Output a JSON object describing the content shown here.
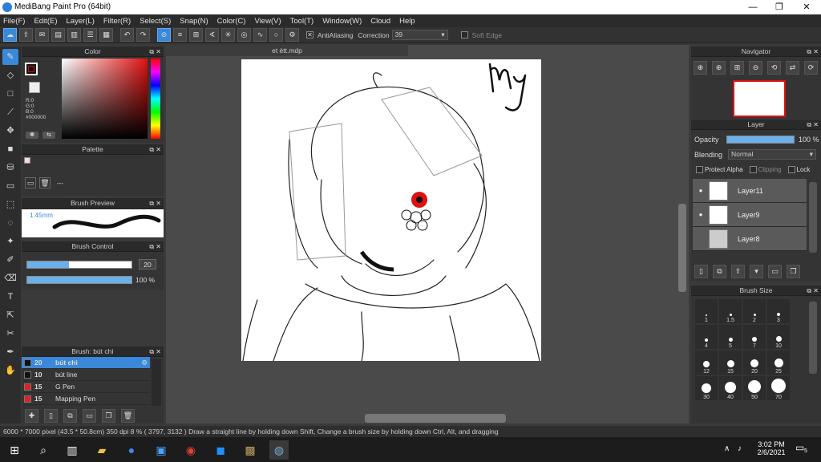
{
  "window": {
    "title": "MediBang Paint Pro (64bit)",
    "min": "—",
    "max": "❐",
    "close": "✕"
  },
  "menu": [
    "File(F)",
    "Edit(E)",
    "Layer(L)",
    "Filter(R)",
    "Select(S)",
    "Snap(N)",
    "Color(C)",
    "View(V)",
    "Tool(T)",
    "Window(W)",
    "Cloud",
    "Help"
  ],
  "toolbar": {
    "antialiasing_label": "AntiAliasing",
    "correction_label": "Correction",
    "correction_value": "39",
    "soft_edge_label": "Soft Edge"
  },
  "color_panel": {
    "title": "Color",
    "r": "R:0",
    "g": "G:0",
    "b": "B:0",
    "hex": "#000000",
    "fg_color": "#cc1111"
  },
  "palette_panel": {
    "title": "Palette",
    "item": "---"
  },
  "brush_preview": {
    "title": "Brush Preview",
    "size": "1.45mm"
  },
  "brush_control": {
    "title": "Brush Control",
    "size_value": "20",
    "opacity_value": "100 %",
    "size_fill": 0.4,
    "opacity_fill": 1.0
  },
  "brush_list": {
    "title": "Brush: bút chì",
    "items": [
      {
        "num": "20",
        "name": "bút chì",
        "color": "#111111",
        "selected": true
      },
      {
        "num": "10",
        "name": "bút line",
        "color": "#111111",
        "selected": false
      },
      {
        "num": "15",
        "name": "G Pen",
        "color": "#dd2222",
        "selected": false
      },
      {
        "num": "15",
        "name": "Mapping Pen",
        "color": "#dd2222",
        "selected": false
      }
    ]
  },
  "document": {
    "tab": "et ètt.mdp",
    "handwriting": "My"
  },
  "navigator": {
    "title": "Navigator"
  },
  "layer_panel": {
    "title": "Layer",
    "opacity_label": "Opacity",
    "opacity_value": "100 %",
    "opacity_fill": 1.0,
    "blending_label": "Blending",
    "blending_value": "Normal",
    "protect_alpha": "Protect Alpha",
    "clipping": "Clipping",
    "lock": "Lock",
    "layers": [
      {
        "name": "Layer11",
        "visible": true
      },
      {
        "name": "Layer9",
        "visible": true
      },
      {
        "name": "Layer8",
        "visible": false
      }
    ]
  },
  "brush_size": {
    "title": "Brush Size",
    "sizes": [
      "1",
      "1.5",
      "2",
      "3",
      "4",
      "5",
      "7",
      "10",
      "12",
      "15",
      "20",
      "25",
      "30",
      "40",
      "50",
      "70"
    ]
  },
  "status": {
    "text": "6000 * 7000 pixel   (43.5 * 50.8cm)   350 dpi   8 %   ( 3797, 3132 )   Draw a straight line by holding down Shift, Change a brush size by holding down Ctrl, Alt, and dragging"
  },
  "taskbar": {
    "time": "3:02 PM",
    "date": "2/6/2021",
    "notif_count": "5"
  }
}
